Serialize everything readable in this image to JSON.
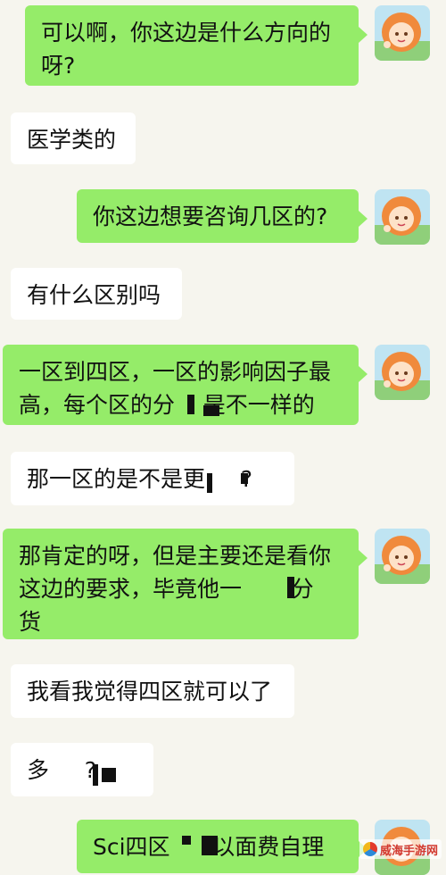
{
  "messages": [
    {
      "side": "me",
      "text": "可以啊，你这边是什么方向的\n呀?"
    },
    {
      "side": "them",
      "text": "医学类的"
    },
    {
      "side": "me",
      "text": "你这边想要咨询几区的?"
    },
    {
      "side": "them",
      "text": "有什么区别吗"
    },
    {
      "side": "me",
      "text": "一区到四区，一区的影响因子最\n高，每个区的分    是不一样的"
    },
    {
      "side": "them",
      "text": "那一区的是不是更     ?"
    },
    {
      "side": "me",
      "text": "那肯定的呀，但是主要还是看你\n这边的要求，毕竟他一       分\n货"
    },
    {
      "side": "them",
      "text": "我看我觉得四区就可以了"
    },
    {
      "side": "them",
      "text": "多     ?"
    },
    {
      "side": "me",
      "text": "Sci四区      以面费自理"
    }
  ],
  "avatar_icon": "anime-girl-avatar",
  "watermark": {
    "text": "威海手游网",
    "icon": "watermark-logo"
  },
  "colors": {
    "me_bubble": "#95ec69",
    "them_bubble": "#ffffff",
    "background": "#f6f5ee"
  }
}
